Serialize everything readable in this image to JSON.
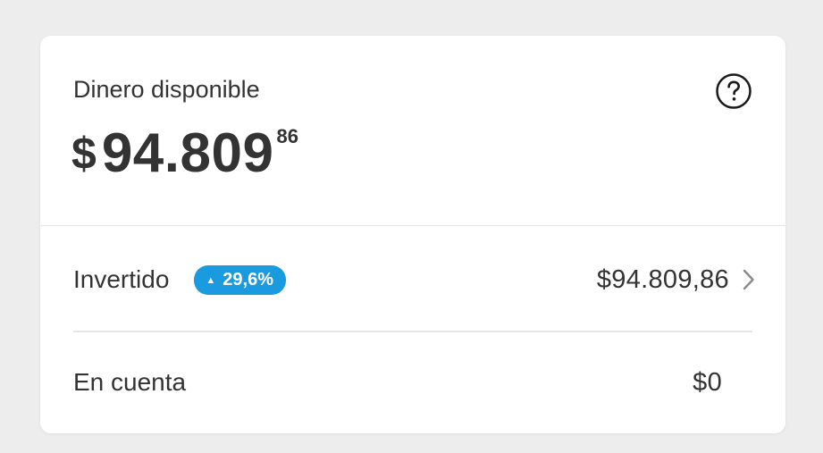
{
  "card": {
    "title": "Dinero disponible",
    "help_icon": "question-circle-icon",
    "amount": {
      "currency": "$",
      "integer": "94.809",
      "cents": "86"
    }
  },
  "rows": [
    {
      "label": "Invertido",
      "badge": {
        "icon": "triangle-up-icon",
        "arrow": "▲",
        "value": "29,6%",
        "color": "#1a9be0"
      },
      "value": "$94.809,86",
      "chevron_icon": "chevron-right-icon"
    },
    {
      "label": "En cuenta",
      "value": "$0"
    }
  ]
}
